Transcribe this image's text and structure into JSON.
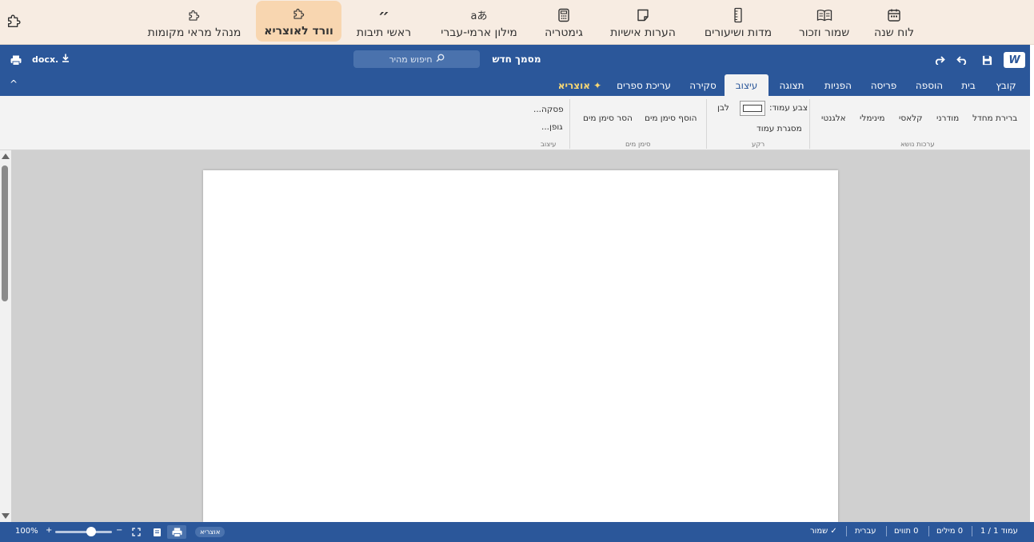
{
  "topbar": {
    "tools": [
      {
        "label": "לוח שנה",
        "icon": "calendar-icon"
      },
      {
        "label": "שמור וזכור",
        "icon": "book-icon"
      },
      {
        "label": "מדות ושיעורים",
        "icon": "ruler-icon"
      },
      {
        "label": "הערות אישיות",
        "icon": "sticky-note-icon"
      },
      {
        "label": "גימטריה",
        "icon": "calculator-icon"
      },
      {
        "label": "מילון ארמי-עברי",
        "icon": "translate-icon"
      },
      {
        "label": "ראשי תיבות",
        "icon": "quote-icon"
      },
      {
        "label": "וורד לאוצריא",
        "icon": "puzzle-icon"
      },
      {
        "label": "מנהל מראי מקומות",
        "icon": "puzzle-icon"
      }
    ],
    "quote_glyph": "״",
    "translate_glyph": "aあ"
  },
  "titlebar": {
    "logo": "W",
    "doc_title": "מסמך חדש",
    "search_placeholder": "חיפוש מהיר",
    "download_label": "docx."
  },
  "tabs": [
    {
      "label": "קובץ"
    },
    {
      "label": "בית"
    },
    {
      "label": "הוספה"
    },
    {
      "label": "פריסה"
    },
    {
      "label": "הפניות"
    },
    {
      "label": "תצוגה"
    },
    {
      "label": "עיצוב",
      "active": true
    },
    {
      "label": "סקירה"
    },
    {
      "label": "עריכת ספרים"
    },
    {
      "label": "✦ אוצריא",
      "special": true
    }
  ],
  "collapse_glyph": "^",
  "ribbon": {
    "theme": {
      "items": [
        "ברירת מחדל",
        "מודרני",
        "קלאסי",
        "מינימלי",
        "אלגנטי"
      ],
      "group": "ערכות נושא"
    },
    "background": {
      "page_color_label": "צבע עמוד:",
      "color_name": "לבן",
      "page_border": "מסגרת עמוד",
      "group": "רקע"
    },
    "watermark": {
      "add": "הוסף סימן מים",
      "remove": "הסר סימן מים",
      "group": "סימן מים"
    },
    "format": {
      "paragraph": "פסקה...",
      "font": "גופן...",
      "group": "עיצוב"
    }
  },
  "status": {
    "page": "עמוד 1 / 1",
    "words": "0 מילים",
    "chars": "0 תווים",
    "language": "עברית",
    "saved": "✓ שמור",
    "badge": "אוצריא",
    "zoom": "100%",
    "zoom_minus": "−",
    "zoom_plus": "+"
  }
}
